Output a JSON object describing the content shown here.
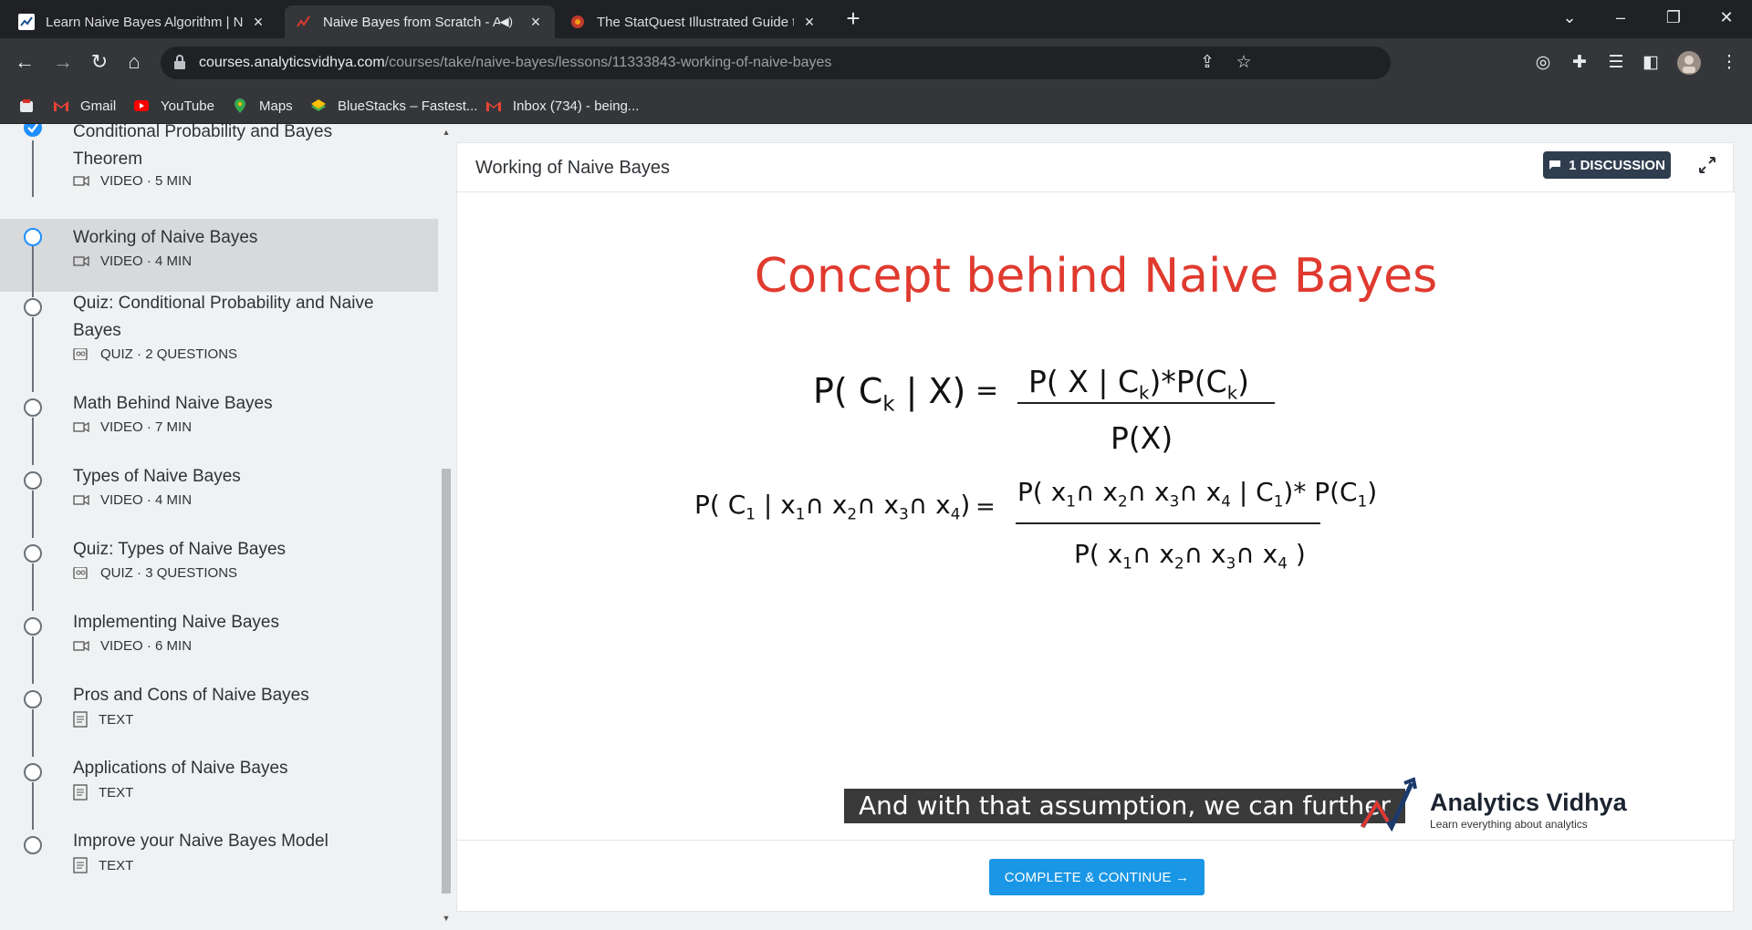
{
  "browser": {
    "tabs": [
      {
        "title": "Learn Naive Bayes Algorithm | N",
        "active": false
      },
      {
        "title": "Naive Bayes from Scratch - A",
        "active": true,
        "audio": true
      },
      {
        "title": "The StatQuest Illustrated Guide t",
        "active": false
      }
    ],
    "url": {
      "host": "courses.analyticsvidhya.com",
      "path": "/courses/take/naive-bayes/lessons/11333843-working-of-naive-bayes"
    },
    "bookmarks": [
      "Gmail",
      "YouTube",
      "Maps",
      "BlueStacks – Fastest...",
      "Inbox (734) - being..."
    ],
    "colors": {
      "frame": "#202124",
      "toolbar": "#35363a"
    }
  },
  "sidebar": {
    "lessons": [
      {
        "title": "Conditional Probability and Bayes Theorem",
        "type": "VIDEO",
        "detail": "5 MIN",
        "status": "completed"
      },
      {
        "title": "Working of Naive Bayes",
        "type": "VIDEO",
        "detail": "4 MIN",
        "status": "current"
      },
      {
        "title": "Quiz: Conditional Probability and Naive Bayes",
        "type": "QUIZ",
        "detail": "2 QUESTIONS",
        "status": "pending"
      },
      {
        "title": "Math Behind Naive Bayes",
        "type": "VIDEO",
        "detail": "7 MIN",
        "status": "pending"
      },
      {
        "title": "Types of Naive Bayes",
        "type": "VIDEO",
        "detail": "4 MIN",
        "status": "pending"
      },
      {
        "title": "Quiz: Types of Naive Bayes",
        "type": "QUIZ",
        "detail": "3 QUESTIONS",
        "status": "pending"
      },
      {
        "title": "Implementing Naive Bayes",
        "type": "VIDEO",
        "detail": "6 MIN",
        "status": "pending"
      },
      {
        "title": "Pros and Cons of Naive Bayes",
        "type": "TEXT",
        "detail": "",
        "status": "pending"
      },
      {
        "title": "Applications of Naive Bayes",
        "type": "TEXT",
        "detail": "",
        "status": "pending"
      },
      {
        "title": "Improve your Naive Bayes Model",
        "type": "TEXT",
        "detail": "",
        "status": "pending"
      }
    ],
    "colors": {
      "accent": "#1e90ff",
      "current_bg": "#d7d9db"
    }
  },
  "content": {
    "title": "Working of Naive Bayes",
    "discussion_label": "1 DISCUSSION",
    "slide": {
      "heading": "Concept behind Naive Bayes",
      "caption": "And with that assumption, we can further",
      "logo_name": "Analytics Vidhya",
      "logo_tagline": "Learn everything about analytics"
    },
    "complete_label": "COMPLETE & CONTINUE →",
    "colors": {
      "heading": "#e03a2f",
      "button": "#1a96e6",
      "discussion": "#2f3d4f"
    }
  }
}
